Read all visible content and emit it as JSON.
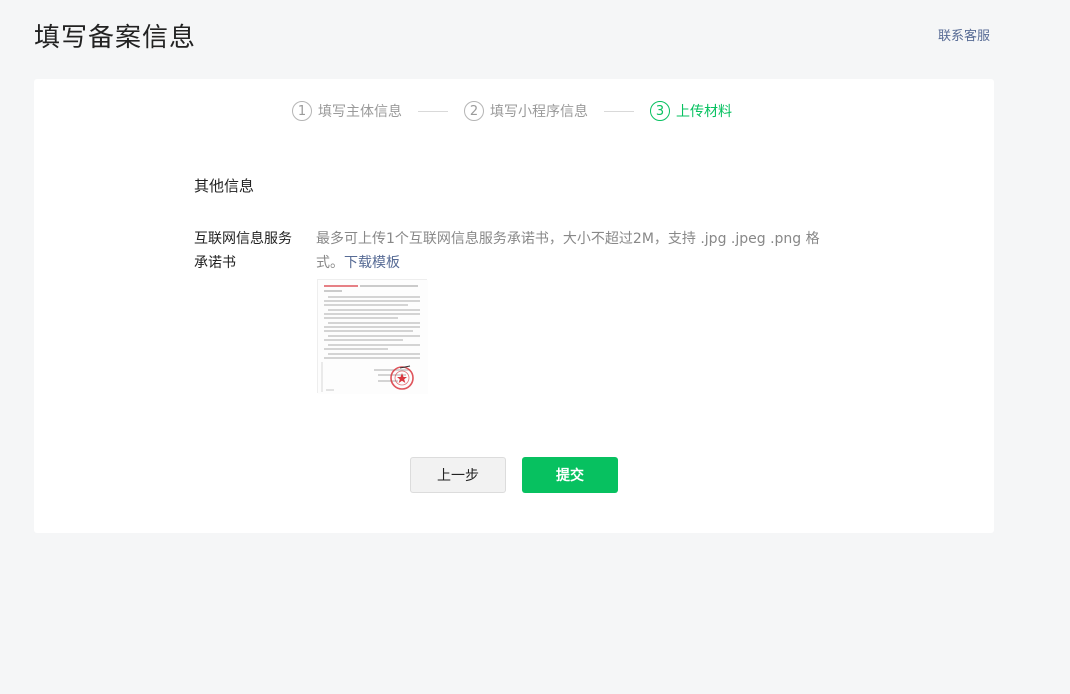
{
  "header": {
    "title": "填写备案信息",
    "contact_label": "联系客服"
  },
  "steps": [
    {
      "num": "1",
      "label": "填写主体信息",
      "active": false
    },
    {
      "num": "2",
      "label": "填写小程序信息",
      "active": false
    },
    {
      "num": "3",
      "label": "上传材料",
      "active": true
    }
  ],
  "section": {
    "title": "其他信息"
  },
  "upload_field": {
    "label": "互联网信息服务承诺书",
    "description": "最多可上传1个互联网信息服务承诺书，大小不超过2M，支持 .jpg .jpeg .png 格式。",
    "download_link": "下载模板"
  },
  "buttons": {
    "prev_label": "上一步",
    "submit_label": "提交"
  },
  "colors": {
    "accent": "#07c160",
    "link": "#576b95",
    "stamp": "#d9363e"
  }
}
